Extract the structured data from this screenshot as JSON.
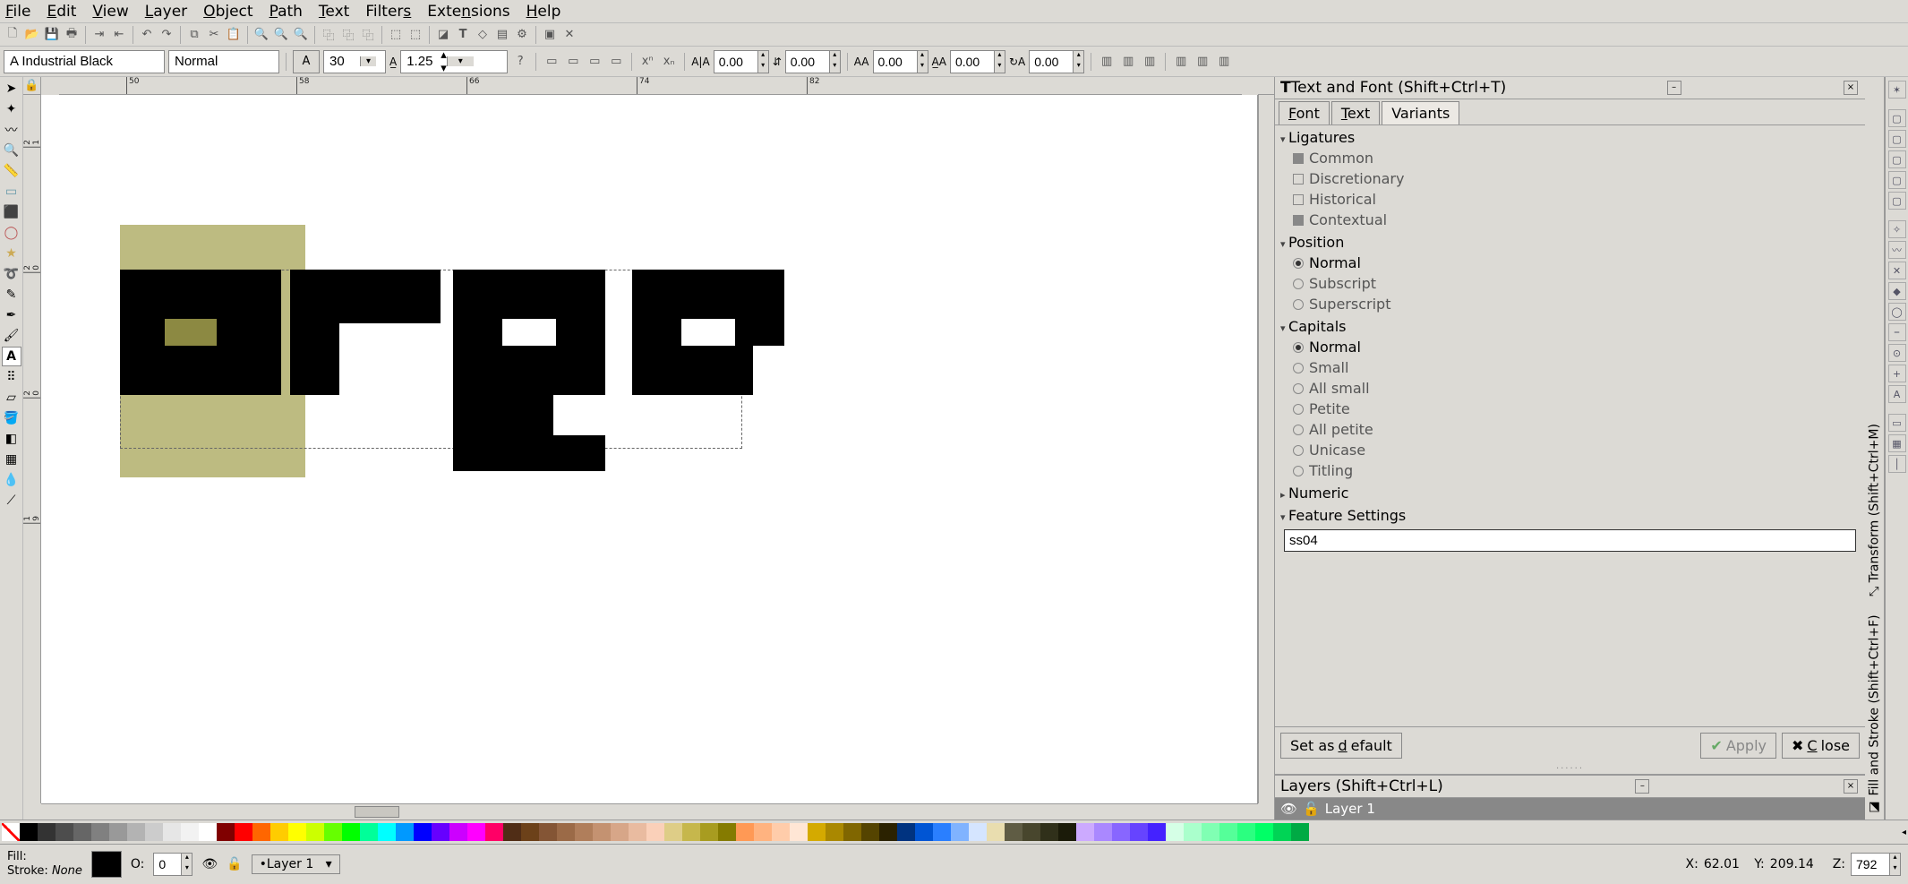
{
  "menu": {
    "file": "File",
    "edit": "Edit",
    "view": "View",
    "layer": "Layer",
    "object": "Object",
    "path": "Path",
    "text": "Text",
    "filters": "Filters",
    "extensions": "Extensions",
    "help": "Help"
  },
  "font_toolbar": {
    "font_family": "A Industrial Black",
    "font_style": "Normal",
    "font_size": "30",
    "line_height": "1.25",
    "h_kern": "0.00",
    "v_kern": "0.00",
    "rotation": "0.00",
    "dx": "0.00",
    "dy": "0.00"
  },
  "ruler_h": [
    50,
    58,
    66,
    74,
    82
  ],
  "ruler_v_groups": [
    [
      2,
      1,
      0
    ],
    [
      2,
      0,
      5
    ],
    [
      2,
      0,
      0
    ],
    [
      1,
      9,
      5
    ]
  ],
  "text_font_panel": {
    "title": "Text and Font (Shift+Ctrl+T)",
    "tabs": {
      "font": "Font",
      "text": "Text",
      "variants": "Variants"
    },
    "ligatures": {
      "head": "Ligatures",
      "common": "Common",
      "discretionary": "Discretionary",
      "historical": "Historical",
      "contextual": "Contextual"
    },
    "position": {
      "head": "Position",
      "normal": "Normal",
      "subscript": "Subscript",
      "superscript": "Superscript"
    },
    "capitals": {
      "head": "Capitals",
      "normal": "Normal",
      "small": "Small",
      "allsmall": "All small",
      "petite": "Petite",
      "allpetite": "All petite",
      "unicase": "Unicase",
      "titling": "Titling"
    },
    "numeric": {
      "head": "Numeric"
    },
    "feature": {
      "head": "Feature Settings",
      "value": "ss04"
    },
    "set_default": "Set as default",
    "apply": "Apply",
    "close": "Close"
  },
  "layers_panel": {
    "title": "Layers (Shift+Ctrl+L)",
    "layer1": "Layer 1"
  },
  "side_tabs": {
    "transform": "Transform (Shift+Ctrl+M)",
    "fillstroke": "Fill and Stroke (Shift+Ctrl+F)"
  },
  "swatch_colors": [
    "#000000",
    "#333333",
    "#4d4d4d",
    "#666666",
    "#808080",
    "#999999",
    "#b3b3b3",
    "#cccccc",
    "#e6e6e6",
    "#f2f2f2",
    "#ffffff",
    "#800000",
    "#ff0000",
    "#ff6600",
    "#ffcc00",
    "#ffff00",
    "#ccff00",
    "#66ff00",
    "#00ff00",
    "#00ff99",
    "#00ffff",
    "#0099ff",
    "#0000ff",
    "#6600ff",
    "#cc00ff",
    "#ff00ff",
    "#ff0066",
    "#502d16",
    "#6c4119",
    "#845535",
    "#9b6a47",
    "#b07e5b",
    "#c49271",
    "#d7a688",
    "#e9bba0",
    "#fad0b9",
    "#decd87",
    "#c6b74c",
    "#a89c20",
    "#857b00",
    "#ff9955",
    "#ffb380",
    "#ffccaa",
    "#ffe6d5",
    "#d4aa00",
    "#aa8800",
    "#806600",
    "#554400",
    "#2b2200",
    "#003380",
    "#0055d4",
    "#2a7fff",
    "#80b3ff",
    "#d5e5ff",
    "#e9ddaf",
    "#5f5c44",
    "#48462d",
    "#30301a",
    "#1b1b09",
    "#ccaaff",
    "#aa88ff",
    "#8866ff",
    "#6644ff",
    "#4422ff",
    "#d5ffe6",
    "#aaffcc",
    "#80ffb3",
    "#55ff99",
    "#2bff80",
    "#00ff66",
    "#00d455",
    "#00aa44"
  ],
  "statusbar": {
    "fill_label": "Fill:",
    "stroke_label": "Stroke:",
    "stroke_val": "None",
    "opacity_label": "O:",
    "opacity": "0",
    "layer": "Layer 1",
    "x_label": "X:",
    "x": "62.01",
    "y_label": "Y:",
    "y": "209.14",
    "z_label": "Z:",
    "z": "792"
  },
  "chart_data": null
}
